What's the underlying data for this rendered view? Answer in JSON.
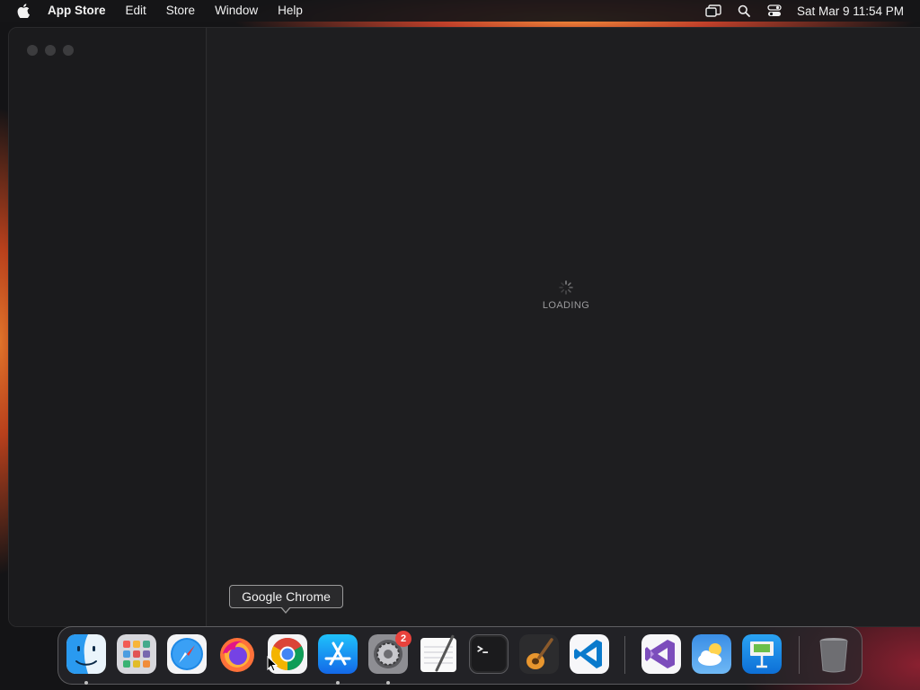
{
  "menubar": {
    "app_name": "App Store",
    "items": [
      "Edit",
      "Store",
      "Window",
      "Help"
    ],
    "clock": "Sat Mar 9  11:54 PM"
  },
  "window": {
    "loading_text": "LOADING"
  },
  "tooltip": {
    "text": "Google Chrome"
  },
  "dock": {
    "items": [
      {
        "name": "Finder",
        "icon": "finder-icon",
        "running": true
      },
      {
        "name": "Launchpad",
        "icon": "launchpad-icon",
        "running": false
      },
      {
        "name": "Safari",
        "icon": "safari-icon",
        "running": false
      },
      {
        "name": "Firefox",
        "icon": "firefox-icon",
        "running": false
      },
      {
        "name": "Google Chrome",
        "icon": "chrome-icon",
        "running": false
      },
      {
        "name": "App Store",
        "icon": "app-store-icon",
        "running": true
      },
      {
        "name": "System Preferences",
        "icon": "system-preferences-icon",
        "running": true,
        "badge": "2"
      },
      {
        "name": "TextEdit",
        "icon": "textedit-icon",
        "running": false
      },
      {
        "name": "Terminal",
        "icon": "terminal-icon",
        "running": false
      },
      {
        "name": "GarageBand",
        "icon": "garageband-icon",
        "running": false
      },
      {
        "name": "Visual Studio Code",
        "icon": "vscode-icon",
        "running": false
      },
      {
        "name": "Visual Studio",
        "icon": "visual-studio-icon",
        "running": false
      },
      {
        "name": "Weather",
        "icon": "weather-icon",
        "running": false
      },
      {
        "name": "Keynote",
        "icon": "keynote-icon",
        "running": false
      },
      {
        "name": "Trash",
        "icon": "trash-icon",
        "running": false
      }
    ],
    "system_preferences_badge": "2"
  },
  "colors": {
    "badge": "#e8423c",
    "window_bg": "#1e1e20",
    "sidebar_bg": "#1b1b1d"
  }
}
